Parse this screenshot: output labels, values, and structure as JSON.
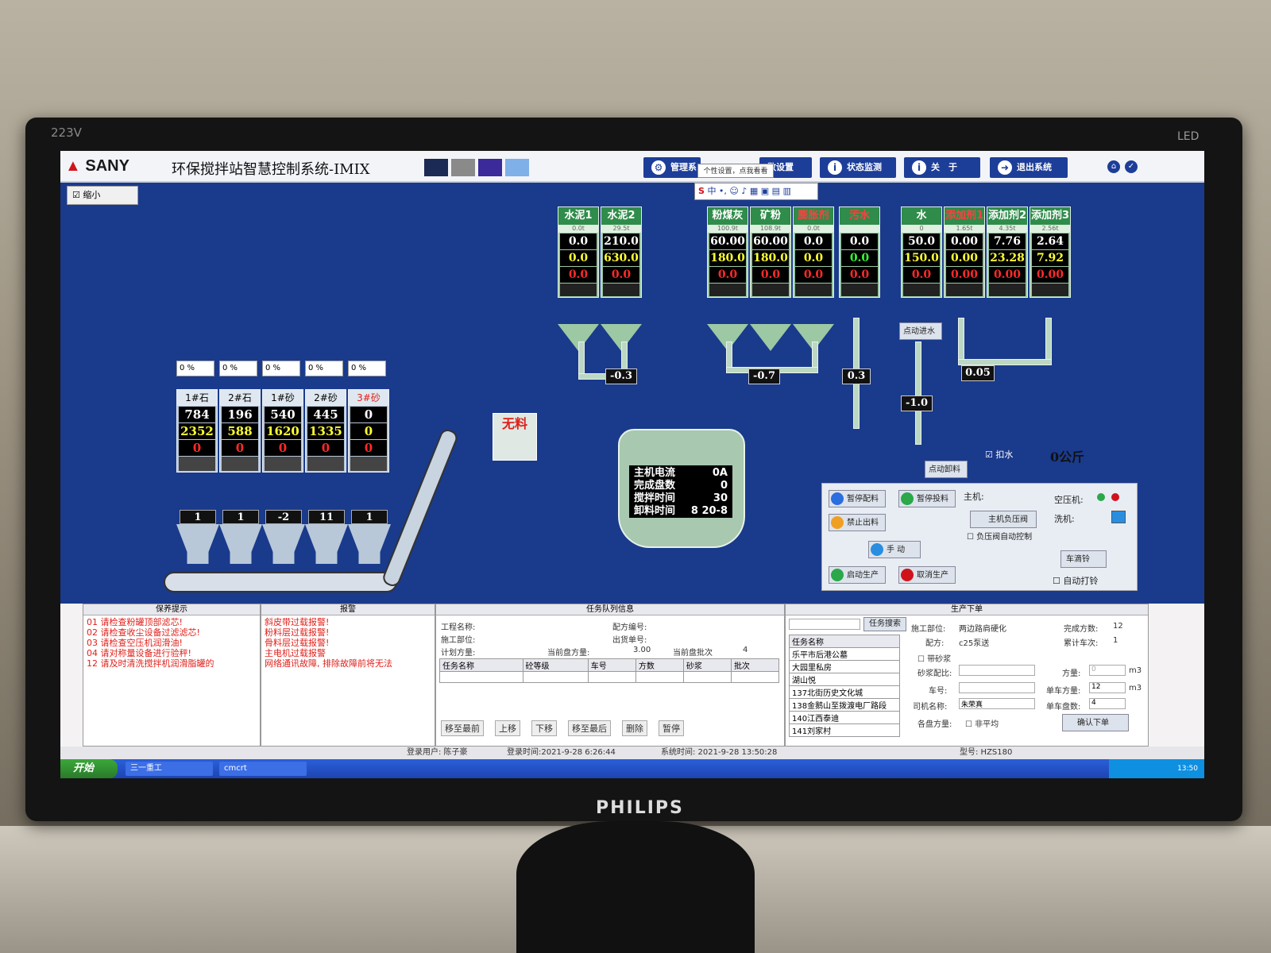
{
  "bezel": {
    "model": "223V",
    "led": "LED",
    "brand": "PHILIPS"
  },
  "app": {
    "brand": "SANY",
    "title": "环保搅拌站智慧控制系统-IMIX",
    "swatches": [
      "#1a2a55",
      "#8a8a8a",
      "#3a2a9a",
      "#7fb0e8"
    ],
    "toolbar": [
      {
        "label": "管理系",
        "icon": "gear-icon"
      },
      {
        "label": "数设置",
        "icon": "settings-icon"
      },
      {
        "label": "状态监测",
        "icon": "info-icon"
      },
      {
        "label": "关　于",
        "icon": "info-icon"
      },
      {
        "label": "退出系统",
        "icon": "exit-icon"
      }
    ],
    "tooltip": "个性设置，点我看看",
    "ime": {
      "s": "S",
      "text": "中 •, ☺ ♪ ▦ ▣ ▤ ▥"
    },
    "shrink_label": "缩小"
  },
  "silos": [
    {
      "label": "水泥1",
      "stock": "0.0t",
      "v1": "0.0",
      "v2": "0.0",
      "v3": "0.0"
    },
    {
      "label": "水泥2",
      "stock": "29.5t",
      "v1": "210.0",
      "v2": "630.0",
      "v3": "0.0"
    },
    {
      "label": "粉煤灰",
      "stock": "100.9t",
      "v1": "60.00",
      "v2": "180.0",
      "v3": "0.0"
    },
    {
      "label": "矿粉",
      "stock": "108.9t",
      "v1": "60.00",
      "v2": "180.0",
      "v3": "0.0"
    },
    {
      "label": "膨胀剂",
      "stock": "0.0t",
      "v1": "0.0",
      "v2": "0.0",
      "v3": "0.0"
    },
    {
      "label": "污水",
      "stock": "",
      "v1": "0.0",
      "v2": "0.0",
      "v3": "0.0"
    }
  ],
  "liquids": [
    {
      "label": "水",
      "stock": "0",
      "v1": "50.0",
      "v2": "150.0",
      "v3": "0.0"
    },
    {
      "label": "添加剂1",
      "stock": "1.65t",
      "v1": "0.00",
      "v2": "0.00",
      "v3": "0.00"
    },
    {
      "label": "添加剂2",
      "stock": "4.35t",
      "v1": "7.76",
      "v2": "23.28",
      "v3": "0.00"
    },
    {
      "label": "添加剂3",
      "stock": "2.56t",
      "v1": "2.64",
      "v2": "7.92",
      "v3": "0.00"
    }
  ],
  "scale_tags": {
    "cement": "-0.3",
    "powder": "-0.7",
    "sewage": "0.3",
    "water": "-1.0",
    "additive": "0.05"
  },
  "water_buttons": {
    "jog_water": "点动进水",
    "jog_discharge": "点动卸料"
  },
  "buckle_water": {
    "label": "扣水",
    "value": "0公斤"
  },
  "aggregates": [
    {
      "label": "1#石",
      "pct": "0 %",
      "v1": "784",
      "v2": "2352",
      "v3": "0",
      "hopper": "1"
    },
    {
      "label": "2#石",
      "pct": "0 %",
      "v1": "196",
      "v2": "588",
      "v3": "0",
      "hopper": "1"
    },
    {
      "label": "1#砂",
      "pct": "0 %",
      "v1": "540",
      "v2": "1620",
      "v3": "0",
      "hopper": "-2"
    },
    {
      "label": "2#砂",
      "pct": "0 %",
      "v1": "445",
      "v2": "1335",
      "v3": "0",
      "hopper": "11"
    },
    {
      "label": "3#砂",
      "pct": "0 %",
      "v1": "0",
      "v2": "0",
      "v3": "0",
      "hopper": "1"
    }
  ],
  "no_material": "无料",
  "mixer": {
    "rows": [
      {
        "k": "主机电流",
        "v": "0A"
      },
      {
        "k": "完成盘数",
        "v": "0"
      },
      {
        "k": "搅拌时间",
        "v": "30"
      },
      {
        "k": "卸料时间",
        "v": "8  20-8"
      }
    ]
  },
  "controls": {
    "pause_batch": "暂停配料",
    "pause_feed": "暂停投料",
    "stop_discharge": "禁止出料",
    "manual": "手 动",
    "start": "启动生产",
    "cancel": "取消生产",
    "host_label": "主机:",
    "host_valve": "主机负压阀",
    "neg_pressure": "负压阀自动控制",
    "compressor": "空压机:",
    "washer": "洗机:",
    "bell": "车滴铃",
    "auto_bell": "自动打铃"
  },
  "maintenance": {
    "title": "保养提示",
    "items": [
      "01  请检查粉罐顶部滤芯!",
      "02  请检查收尘设备过滤滤芯!",
      "03  请检查空压机润滑油!",
      "04  请对称量设备进行验秤!",
      "12  请及时清洗搅拌机润滑脂罐的"
    ]
  },
  "alarms": {
    "title": "报警",
    "items": [
      "斜皮带过载报警!",
      "粉料层过载报警!",
      "骨料层过载报警!",
      "主电机过载报警",
      "网络通讯故障, 排除故障前将无法"
    ]
  },
  "queue": {
    "title": "任务队列信息",
    "project": "工程名称:",
    "site": "施工部位:",
    "plan": "计划方量:",
    "recipe_no": "配方编号:",
    "ticket_no": "出货单号:",
    "cur_volume_label": "当前盘方量:",
    "cur_volume": "3.00",
    "cur_batch_label": "当前盘批次",
    "cur_batch": "4",
    "columns": [
      "任务名称",
      "砼等级",
      "车号",
      "方数",
      "砂浆",
      "批次"
    ],
    "buttons": [
      "移至最前",
      "上移",
      "下移",
      "移至最后",
      "删除",
      "暂停"
    ]
  },
  "production": {
    "title": "生产下单",
    "search_btn": "任务搜索",
    "task_header": "任务名称",
    "tasks": [
      "乐平市后港公墓",
      "大园里私房",
      "湖山悦",
      "137北街历史文化城",
      "138金鹅山至拨渡电厂路段",
      "140江西泰迪",
      "141刘家村"
    ],
    "site_label": "施工部位:",
    "site": "两边路肩硬化",
    "recipe_label": "配方:",
    "recipe": "c25泵送",
    "done_label": "完成方数:",
    "done": "12",
    "trips_label": "累计车次:",
    "trips": "1",
    "mortar": "带砂浆",
    "mortar_ratio": "砂浆配比:",
    "volume_label": "方量:",
    "volume": "0",
    "unit": "m3",
    "car_label": "车号:",
    "truck_volume_label": "单车方量:",
    "truck_volume": "12",
    "driver_label": "司机名称:",
    "driver": "朱荣真",
    "truck_batches_label": "单车盘数:",
    "truck_batches": "4",
    "each_label": "各盘方量:",
    "uneven": "非平均",
    "confirm": "确认下单"
  },
  "status_bar": {
    "user": "登录用户: 陈子豪",
    "login": "登录时间:2021-9-28 6:26:44",
    "sys": "系统时间: 2021-9-28 13:50:28",
    "model": "型号: HZS180"
  },
  "taskbar": {
    "start": "开始",
    "tasks": [
      "三一重工",
      "cmcrt"
    ],
    "clock": "13:50"
  },
  "colors": {
    "screen_bg": "#1a3a8c",
    "silo": "#9cc8a4",
    "alarm": "#e0201a",
    "digit_yellow": "#ffff33"
  }
}
